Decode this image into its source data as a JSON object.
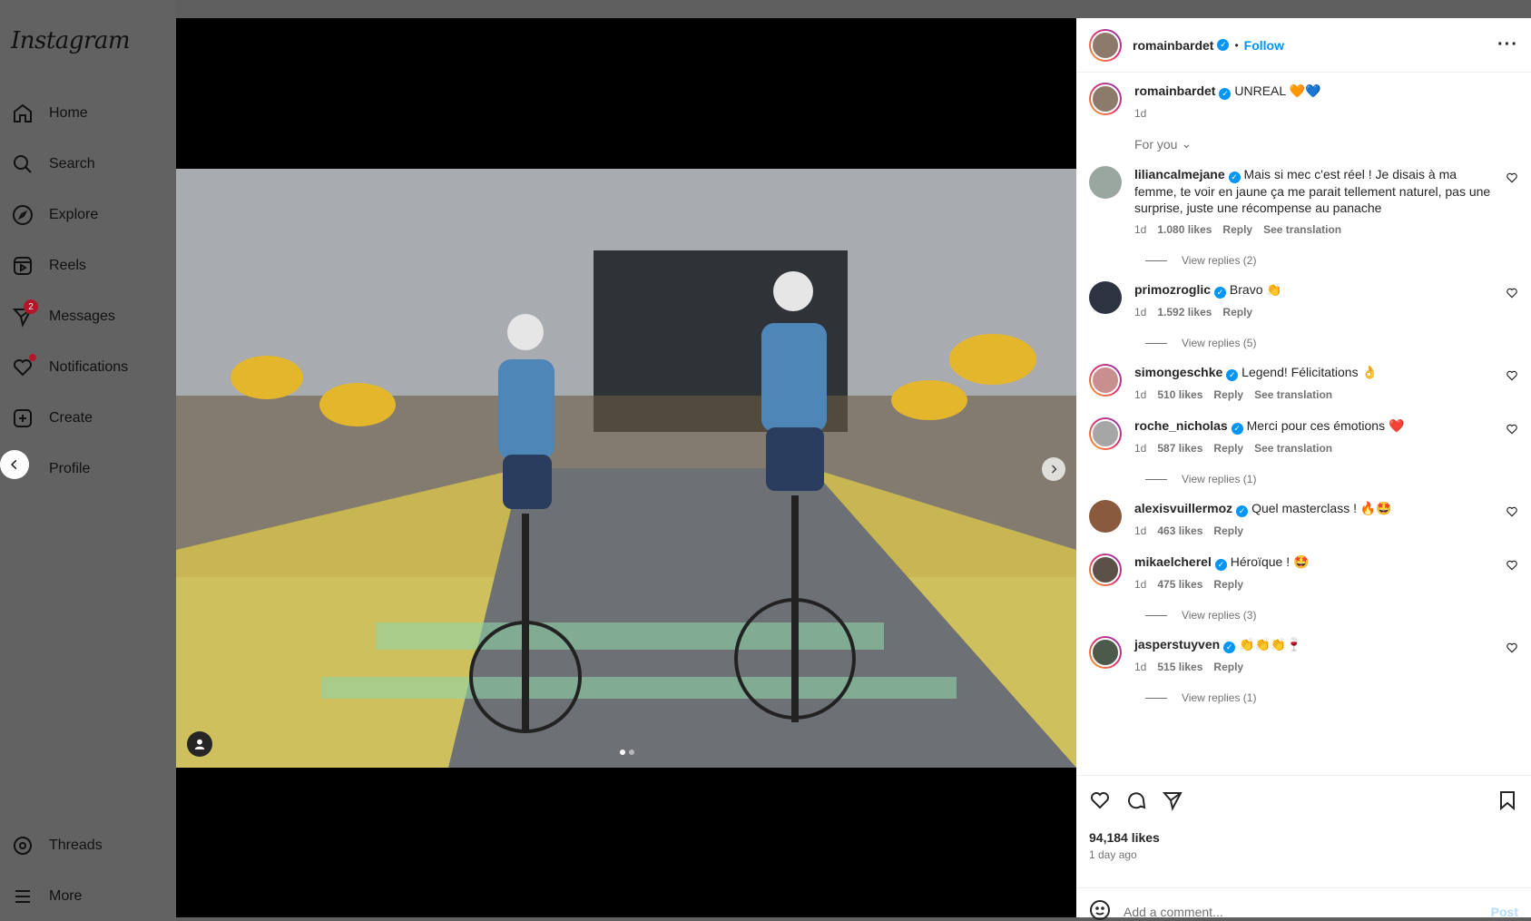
{
  "sidebar": {
    "logo": "Instagram",
    "items": [
      {
        "label": "Home",
        "icon": "home-icon"
      },
      {
        "label": "Search",
        "icon": "search-icon"
      },
      {
        "label": "Explore",
        "icon": "compass-icon"
      },
      {
        "label": "Reels",
        "icon": "reels-icon"
      },
      {
        "label": "Messages",
        "icon": "send-icon",
        "badge": "2"
      },
      {
        "label": "Notifications",
        "icon": "heart-icon"
      },
      {
        "label": "Create",
        "icon": "plus-square-icon"
      },
      {
        "label": "Profile",
        "icon": "avatar-icon"
      }
    ],
    "bottom": [
      {
        "label": "Threads",
        "icon": "threads-icon"
      },
      {
        "label": "More",
        "icon": "menu-icon"
      }
    ]
  },
  "post": {
    "author": "romainbardet",
    "follow_label": "Follow",
    "separator": "•",
    "caption": "UNREAL 🧡💙",
    "caption_time": "1d",
    "sort_label": "For you",
    "likes": "94,184 likes",
    "time_ago": "1 day ago",
    "add_comment_placeholder": "Add a comment...",
    "post_label": "Post"
  },
  "comments": [
    {
      "user": "liliancalmejane",
      "text": "Mais si mec c'est réel ! Je disais à ma femme, te voir en jaune ça me parait tellement naturel, pas une surprise, juste une récompense au panache",
      "time": "1d",
      "likes": "1.080 likes",
      "reply": "Reply",
      "translate": "See translation",
      "replies": "View replies (2)"
    },
    {
      "user": "primozroglic",
      "text": "Bravo 👏",
      "time": "1d",
      "likes": "1.592 likes",
      "reply": "Reply",
      "translate": "",
      "replies": "View replies (5)"
    },
    {
      "user": "simongeschke",
      "text": "Legend! Félicitations 👌",
      "time": "1d",
      "likes": "510 likes",
      "reply": "Reply",
      "translate": "See translation",
      "replies": ""
    },
    {
      "user": "roche_nicholas",
      "text": "Merci pour ces émotions ❤️",
      "time": "1d",
      "likes": "587 likes",
      "reply": "Reply",
      "translate": "See translation",
      "replies": "View replies (1)"
    },
    {
      "user": "alexisvuillermoz",
      "text": "Quel masterclass ! 🔥🤩",
      "time": "1d",
      "likes": "463 likes",
      "reply": "Reply",
      "translate": "",
      "replies": ""
    },
    {
      "user": "mikaelcherel",
      "text": "Héroïque ! 🤩",
      "time": "1d",
      "likes": "475 likes",
      "reply": "Reply",
      "translate": "",
      "replies": "View replies (3)"
    },
    {
      "user": "jasperstuyven",
      "text": "👏👏👏🍷",
      "time": "1d",
      "likes": "515 likes",
      "reply": "Reply",
      "translate": "",
      "replies": "View replies (1)"
    }
  ],
  "colors": {
    "accent": "#0095f6",
    "badge": "#b3162a",
    "muted": "#737373"
  }
}
